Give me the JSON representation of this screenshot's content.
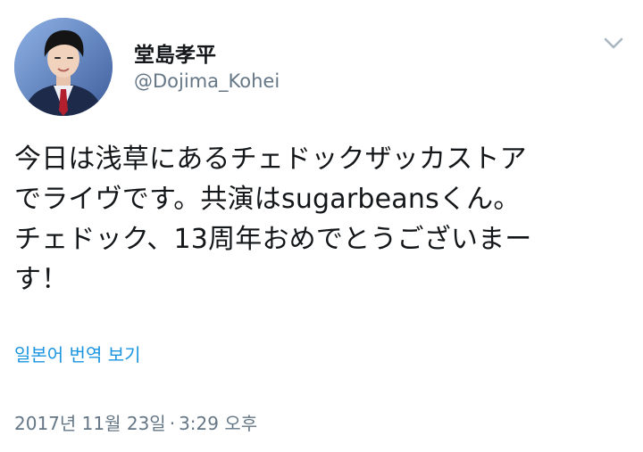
{
  "user": {
    "display_name": "堂島孝平",
    "handle": "@Dojima_Kohei",
    "avatar_icon": "profile-photo"
  },
  "menu": {
    "caret_icon": "chevron-down-icon"
  },
  "tweet": {
    "text": "今日は浅草にあるチェドックザッカストア\nでライヴです。共演はsugarbeansくん。\nチェドック、13周年おめでとうございまー\nす！"
  },
  "translate": {
    "label": "일본어 번역 보기"
  },
  "timestamp": {
    "date": "2017년 11월 23일",
    "separator": "·",
    "time": "3:29 오후"
  },
  "colors": {
    "text": "#14171a",
    "secondary": "#657786",
    "link": "#1b95e0",
    "caret": "#aab8c2"
  }
}
